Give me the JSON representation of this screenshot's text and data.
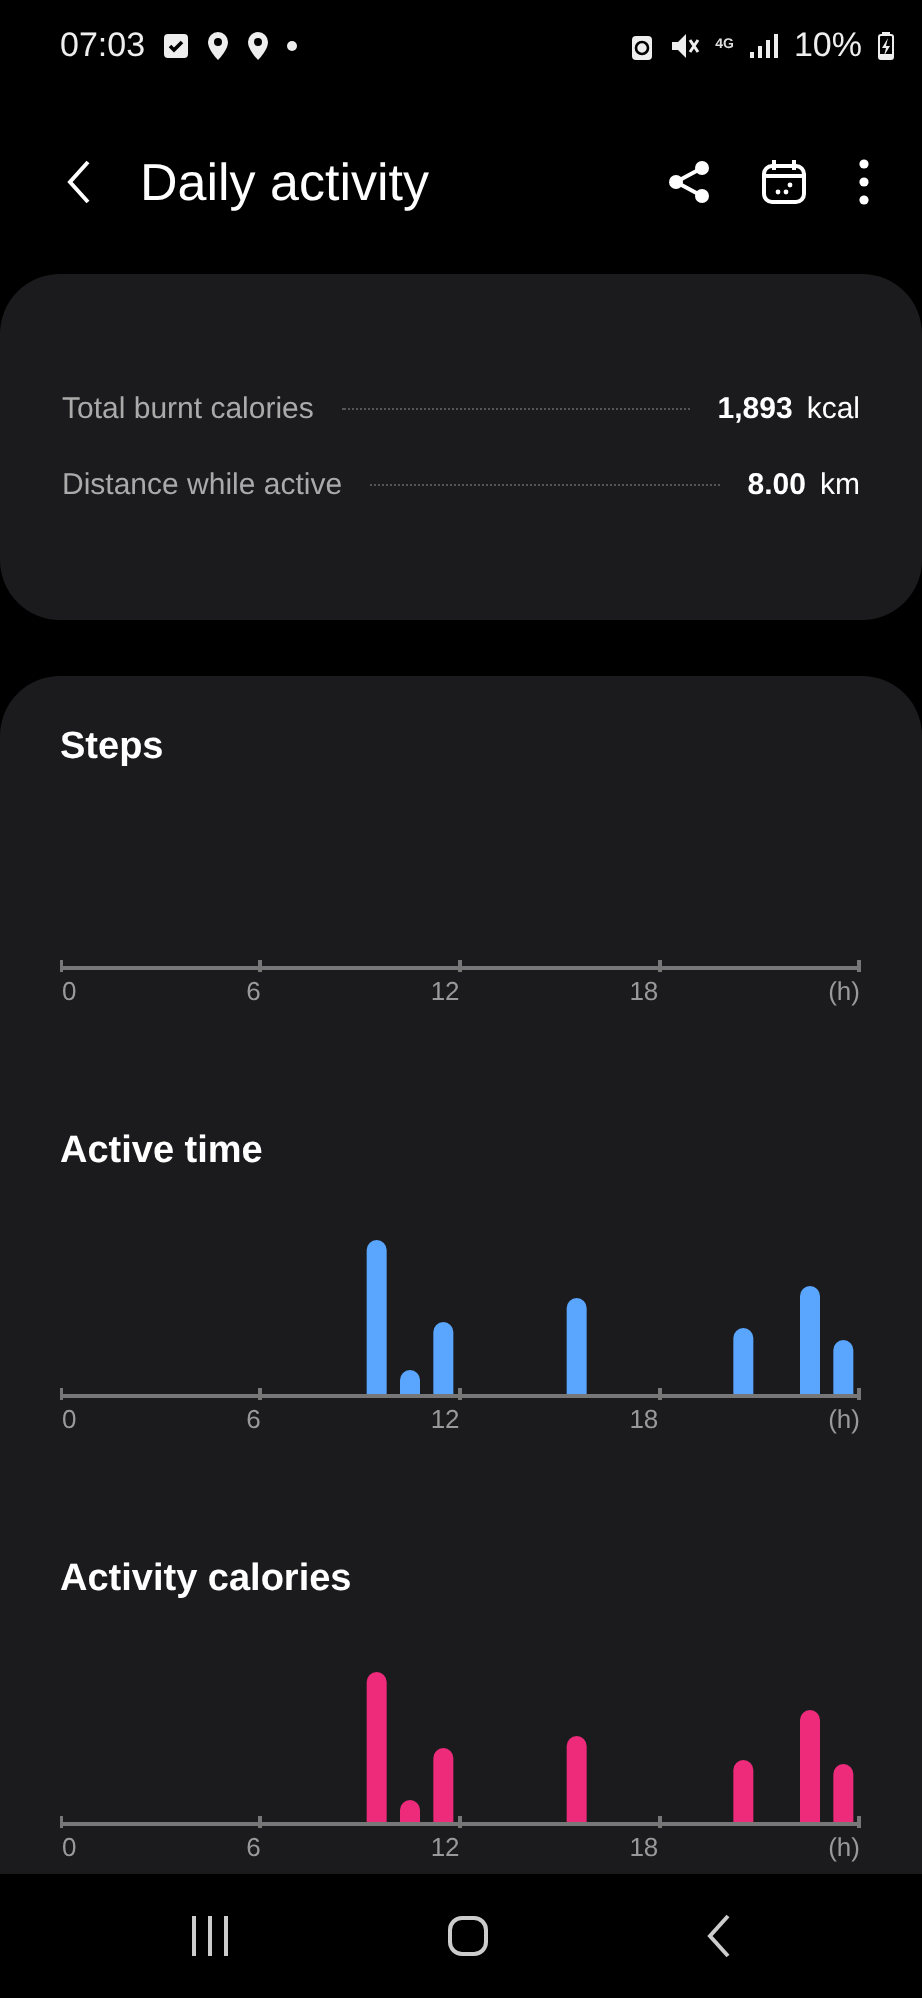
{
  "status_bar": {
    "time": "07:03",
    "network": "4G",
    "battery": "10%"
  },
  "header": {
    "title": "Daily activity"
  },
  "summary": {
    "rows": [
      {
        "label": "Total burnt calories",
        "value": "1,893",
        "unit": "kcal"
      },
      {
        "label": "Distance while active",
        "value": "8.00",
        "unit": "km"
      }
    ]
  },
  "charts": [
    {
      "title": "Steps",
      "kind": "empty",
      "x_labels": [
        "0",
        "6",
        "12",
        "18",
        "(h)"
      ]
    },
    {
      "title": "Active time",
      "kind": "bars",
      "color": "#5aa6ff",
      "x_labels": [
        "0",
        "6",
        "12",
        "18",
        "(h)"
      ]
    },
    {
      "title": "Activity calories",
      "kind": "bars",
      "color": "#ee2a7b",
      "x_labels": [
        "0",
        "6",
        "12",
        "18",
        "(h)"
      ]
    }
  ]
}
